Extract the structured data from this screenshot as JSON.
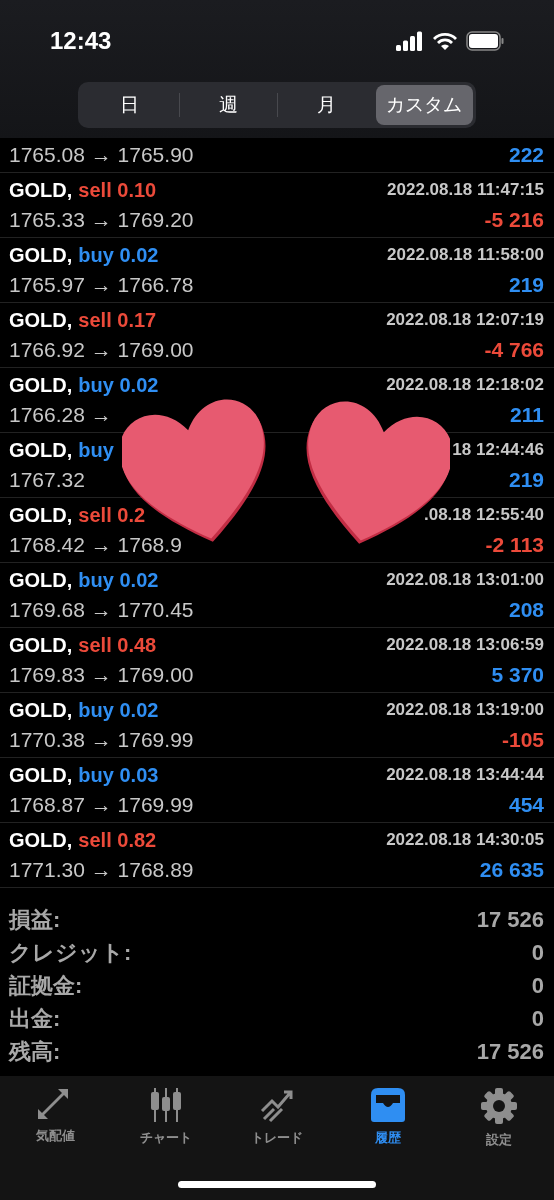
{
  "status_bar": {
    "time": "12:43"
  },
  "periods": [
    {
      "label": "日",
      "selected": false
    },
    {
      "label": "週",
      "selected": false
    },
    {
      "label": "月",
      "selected": false
    },
    {
      "label": "カスタム",
      "selected": true
    }
  ],
  "deals": [
    {
      "prices": "1765.08 → 1765.90",
      "profit": {
        "text": "222",
        "color": "#2f8ef2"
      }
    },
    {
      "symbol": "GOLD,",
      "side": {
        "text": "sell 0.10",
        "color": "#ec4a3a"
      },
      "time": "2022.08.18 11:47:15",
      "prices": "1765.33 → 1769.20",
      "profit": {
        "text": "-5 216",
        "color": "#ec4a3a"
      }
    },
    {
      "symbol": "GOLD,",
      "side": {
        "text": "buy 0.02",
        "color": "#2f8ef2"
      },
      "time": "2022.08.18 11:58:00",
      "prices": "1765.97 → 1766.78",
      "profit": {
        "text": "219",
        "color": "#2f8ef2"
      }
    },
    {
      "symbol": "GOLD,",
      "side": {
        "text": "sell 0.17",
        "color": "#ec4a3a"
      },
      "time": "2022.08.18 12:07:19",
      "prices": "1766.92 → 1769.00",
      "profit": {
        "text": "-4 766",
        "color": "#ec4a3a"
      }
    },
    {
      "symbol": "GOLD,",
      "side": {
        "text": "buy 0.02",
        "color": "#2f8ef2"
      },
      "time": "2022.08.18 12:18:02",
      "prices": "1766.28 →",
      "profit": {
        "text": "211",
        "color": "#2f8ef2"
      }
    },
    {
      "symbol": "GOLD,",
      "side": {
        "text": "buy",
        "color": "#2f8ef2"
      },
      "time": "18 12:44:46",
      "prices": "1767.32",
      "profit": {
        "text": "219",
        "color": "#2f8ef2"
      }
    },
    {
      "symbol": "GOLD,",
      "side": {
        "text": "sell 0.2",
        "color": "#ec4a3a"
      },
      "time": ".08.18 12:55:40",
      "prices": "1768.42 → 1768.9",
      "profit": {
        "text": "-2 113",
        "color": "#ec4a3a"
      }
    },
    {
      "symbol": "GOLD,",
      "side": {
        "text": "buy 0.02",
        "color": "#2f8ef2"
      },
      "time": "2022.08.18 13:01:00",
      "prices": "1769.68 → 1770.45",
      "profit": {
        "text": "208",
        "color": "#2f8ef2"
      }
    },
    {
      "symbol": "GOLD,",
      "side": {
        "text": "sell 0.48",
        "color": "#ec4a3a"
      },
      "time": "2022.08.18 13:06:59",
      "prices": "1769.83 → 1769.00",
      "profit": {
        "text": "5 370",
        "color": "#2f8ef2"
      }
    },
    {
      "symbol": "GOLD,",
      "side": {
        "text": "buy 0.02",
        "color": "#2f8ef2"
      },
      "time": "2022.08.18 13:19:00",
      "prices": "1770.38 → 1769.99",
      "profit": {
        "text": "-105",
        "color": "#ec4a3a"
      }
    },
    {
      "symbol": "GOLD,",
      "side": {
        "text": "buy 0.03",
        "color": "#2f8ef2"
      },
      "time": "2022.08.18 13:44:44",
      "prices": "1768.87 → 1769.99",
      "profit": {
        "text": "454",
        "color": "#2f8ef2"
      }
    },
    {
      "symbol": "GOLD,",
      "side": {
        "text": "sell 0.82",
        "color": "#ec4a3a"
      },
      "time": "2022.08.18 14:30:05",
      "prices": "1771.30 → 1768.89",
      "profit": {
        "text": "26 635",
        "color": "#2f8ef2"
      }
    }
  ],
  "summary": [
    {
      "label": "損益:",
      "value": "17 526"
    },
    {
      "label": "クレジット:",
      "value": "0"
    },
    {
      "label": "証拠金:",
      "value": "0"
    },
    {
      "label": "出金:",
      "value": "0"
    },
    {
      "label": "残高:",
      "value": "17 526"
    }
  ],
  "tab_bar": [
    {
      "label": "気配値",
      "selected": false
    },
    {
      "label": "チャート",
      "selected": false
    },
    {
      "label": "トレード",
      "selected": false
    },
    {
      "label": "履歴",
      "selected": true
    },
    {
      "label": "設定",
      "selected": false
    }
  ]
}
